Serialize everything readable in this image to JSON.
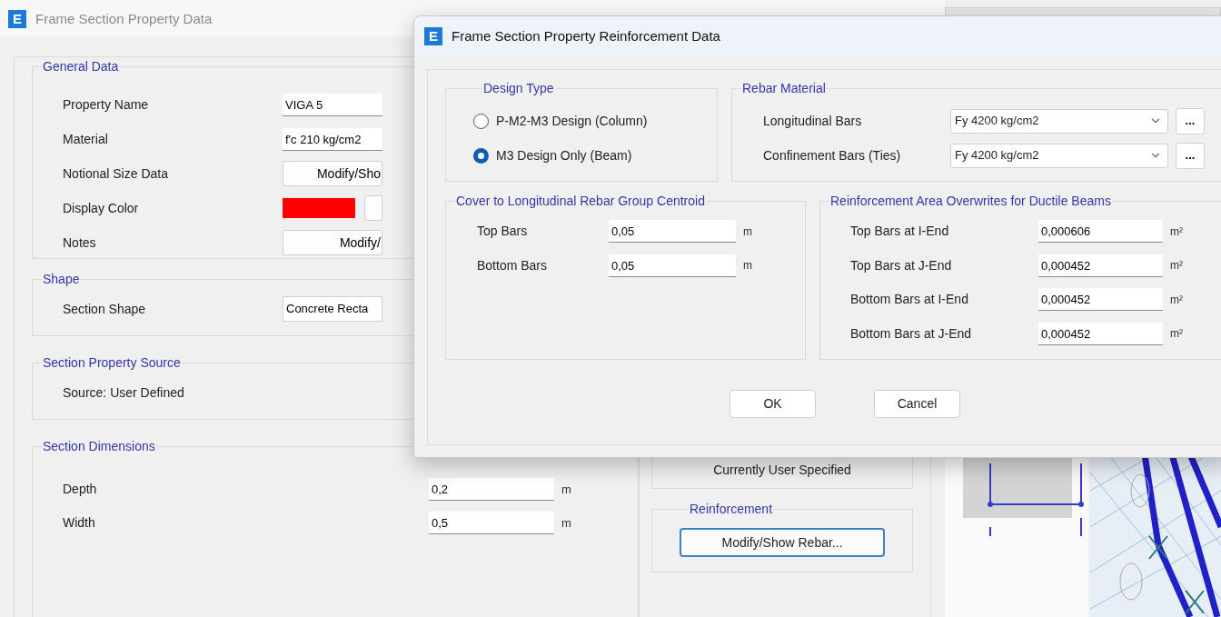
{
  "back_window": {
    "icon_letter": "E",
    "title": "Frame Section Property Data",
    "general_data": {
      "title": "General Data",
      "rows": [
        {
          "label": "Property Name",
          "kind": "text",
          "value": "VIGA 5"
        },
        {
          "label": "Material",
          "kind": "text",
          "value": "f'c 210 kg/cm2"
        },
        {
          "label": "Notional Size Data",
          "kind": "button",
          "value": "Modify/Sho"
        },
        {
          "label": "Display Color",
          "kind": "color",
          "color": "#ff0000"
        },
        {
          "label": "Notes",
          "kind": "button",
          "value": "Modify/"
        }
      ]
    },
    "shape": {
      "title": "Shape",
      "label": "Section Shape",
      "value": "Concrete Recta"
    },
    "source": {
      "title": "Section Property Source",
      "text": "Source:  User Defined"
    },
    "dimensions": {
      "title": "Section Dimensions",
      "rows": [
        {
          "label": "Depth",
          "value": "0,2",
          "unit": "m"
        },
        {
          "label": "Width",
          "value": "0,5",
          "unit": "m"
        }
      ]
    },
    "status": "Currently User Specified",
    "reinforcement": {
      "title": "Reinforcement",
      "button": "Modify/Show Rebar..."
    }
  },
  "dialog": {
    "icon_letter": "E",
    "title": "Frame Section Property Reinforcement Data",
    "design_type": {
      "title": "Design Type",
      "options": [
        {
          "label": "P-M2-M3 Design  (Column)",
          "selected": false
        },
        {
          "label": "M3 Design Only  (Beam)",
          "selected": true
        }
      ]
    },
    "rebar_material": {
      "title": "Rebar Material",
      "rows": [
        {
          "label": "Longitudinal Bars",
          "value": "Fy 4200 kg/cm2",
          "button": "..."
        },
        {
          "label": "Confinement Bars (Ties)",
          "value": "Fy 4200 kg/cm2",
          "button": "..."
        }
      ]
    },
    "cover": {
      "title": "Cover to Longitudinal Rebar Group Centroid",
      "rows": [
        {
          "label": "Top Bars",
          "value": "0,05",
          "unit": "m"
        },
        {
          "label": "Bottom  Bars",
          "value": "0,05",
          "unit": "m"
        }
      ]
    },
    "area_overwrites": {
      "title": "Reinforcement Area Overwrites for Ductile Beams",
      "rows": [
        {
          "label": "Top Bars at I-End",
          "value": "0,000606",
          "unit": "m²"
        },
        {
          "label": "Top Bars at J-End",
          "value": "0,000452",
          "unit": "m²"
        },
        {
          "label": "Bottom Bars at I-End",
          "value": "0,000452",
          "unit": "m²"
        },
        {
          "label": "Bottom Bars at J-End",
          "value": "0,000452",
          "unit": "m²"
        }
      ]
    },
    "buttons": [
      "OK",
      "Cancel"
    ]
  }
}
